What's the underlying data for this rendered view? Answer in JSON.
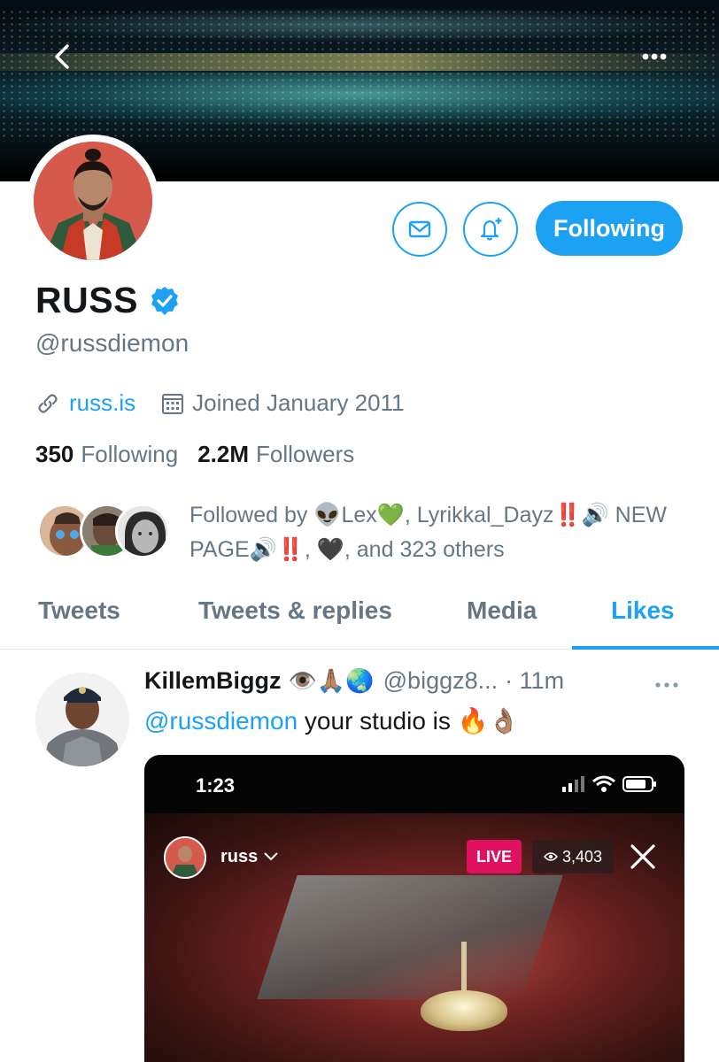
{
  "profile": {
    "name": "RUSS",
    "handle": "@russdiemon",
    "website": "russ.is",
    "joined": "Joined January 2011",
    "following_count": "350",
    "following_label": "Following",
    "followers_count": "2.2M",
    "followers_label": "Followers",
    "follow_button": "Following",
    "followed_by": "Followed by 👽Lex💚, Lyrikkal_Dayz‼️🔊 NEW PAGE🔊‼️, 🖤, and 323 others"
  },
  "tabs": [
    "Tweets",
    "Tweets & replies",
    "Media",
    "Likes"
  ],
  "active_tab": "Likes",
  "tweet": {
    "author": "KillemBiggz",
    "author_emojis": "👁️🙏🏽🌏",
    "handle": "@biggz8...",
    "time": "· 11m",
    "mention": "@russdiemon",
    "text": " your studio is 🔥👌🏽",
    "media": {
      "status_time": "1:23",
      "live_user": "russ",
      "live_label": "LIVE",
      "viewers": "3,403"
    }
  },
  "colors": {
    "accent": "#1da1f2",
    "secondary_text": "#657786",
    "live": "#e0115f"
  }
}
